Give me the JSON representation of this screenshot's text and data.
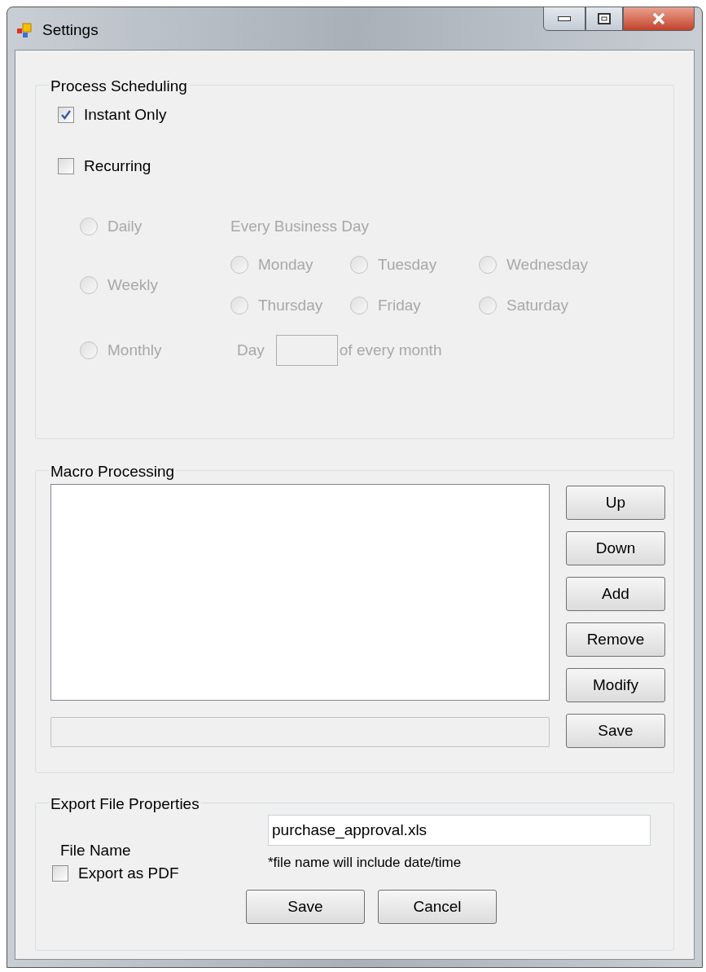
{
  "window": {
    "title": "Settings"
  },
  "process_scheduling": {
    "title": "Process Scheduling",
    "options": [
      {
        "label": "Instant Only",
        "checked": true
      },
      {
        "label": "Recurring",
        "checked": false
      }
    ],
    "disabled": true,
    "frequencies": [
      {
        "label": "Daily",
        "selected": false
      },
      {
        "label": "Weekly",
        "selected": false
      },
      {
        "label": "Monthly",
        "selected": false
      }
    ],
    "business_day_label": "Every Business Day",
    "weekdays": [
      {
        "label": "Monday",
        "selected": false
      },
      {
        "label": "Tuesday",
        "selected": false
      },
      {
        "label": "Wednesday",
        "selected": false
      },
      {
        "label": "Thursday",
        "selected": false
      },
      {
        "label": "Friday",
        "selected": false
      },
      {
        "label": "Saturday",
        "selected": false
      }
    ],
    "day_label": "Day",
    "day_suffix": "of every month"
  },
  "macro_processing": {
    "title": "Macro Processing",
    "buttons": [
      "Up",
      "Down",
      "Add",
      "Remove",
      "Modify",
      "Save"
    ]
  },
  "export_file_properties": {
    "title": "Export File Properties",
    "file_name_label": "File Name",
    "file_name_value": "purchase_approval.xls",
    "note": "*file name will include date/time",
    "export_pdf": {
      "label": "Export as PDF",
      "checked": false
    },
    "buttons": [
      "Save",
      "Cancel"
    ]
  }
}
